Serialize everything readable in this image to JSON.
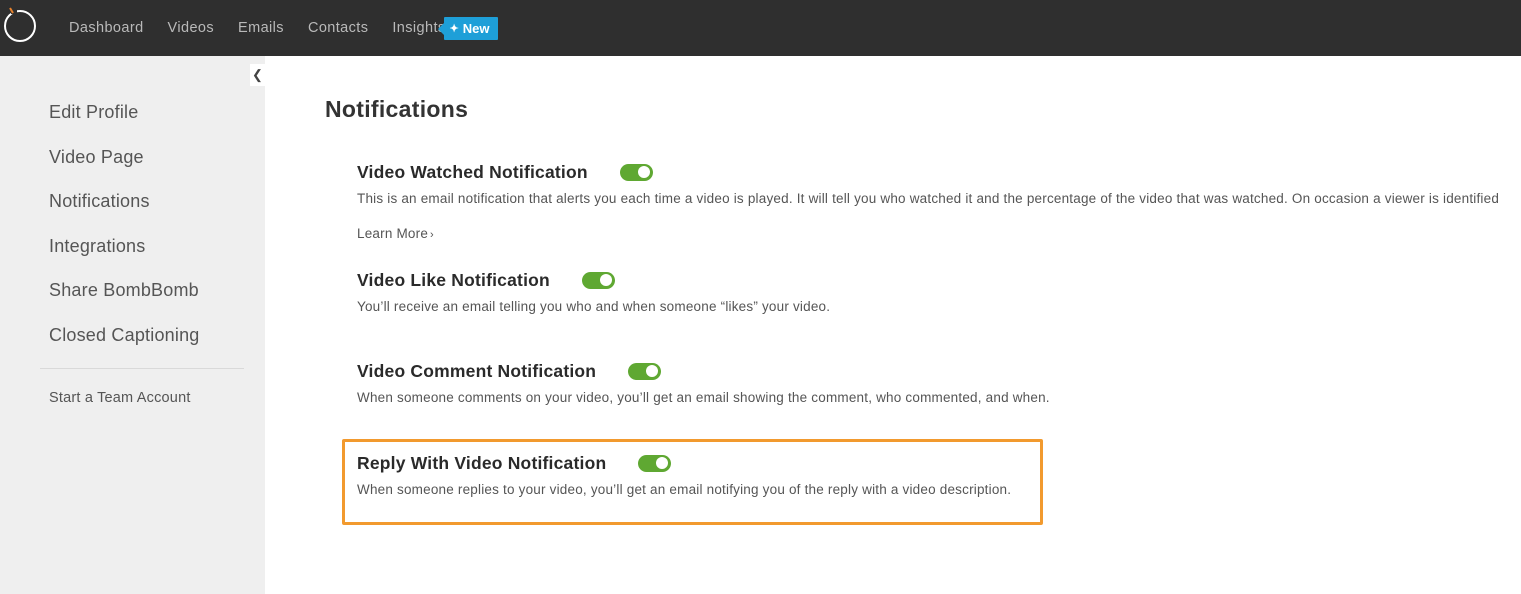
{
  "nav": {
    "items": [
      "Dashboard",
      "Videos",
      "Emails",
      "Contacts",
      "Insights"
    ],
    "new_badge": "New"
  },
  "sidebar": {
    "items": [
      "Edit Profile",
      "Video Page",
      "Notifications",
      "Integrations",
      "Share BombBomb",
      "Closed Captioning"
    ],
    "team_link": "Start a Team Account"
  },
  "main": {
    "title": "Notifications",
    "notifications": [
      {
        "title": "Video Watched Notification",
        "enabled": true,
        "description": "This is an email notification that alerts you each time a video is played. It will tell you who watched it and the percentage of the video that was watched. On occasion a viewer is identified",
        "learn_more": "Learn More"
      },
      {
        "title": "Video Like Notification",
        "enabled": true,
        "description": "You’ll receive an email telling you who and when someone “likes” your video."
      },
      {
        "title": "Video Comment Notification",
        "enabled": true,
        "description": "When someone comments on your video, you’ll get an email showing the comment, who commented, and when."
      },
      {
        "title": "Reply With Video Notification",
        "enabled": true,
        "description": "When someone replies to your video, you’ll get an email notifying you of the reply with a video description."
      }
    ]
  },
  "colors": {
    "topbar": "#2f2f2f",
    "toggle_on": "#5fa832",
    "badge": "#1e9fd8",
    "highlight": "#f29a2e"
  }
}
